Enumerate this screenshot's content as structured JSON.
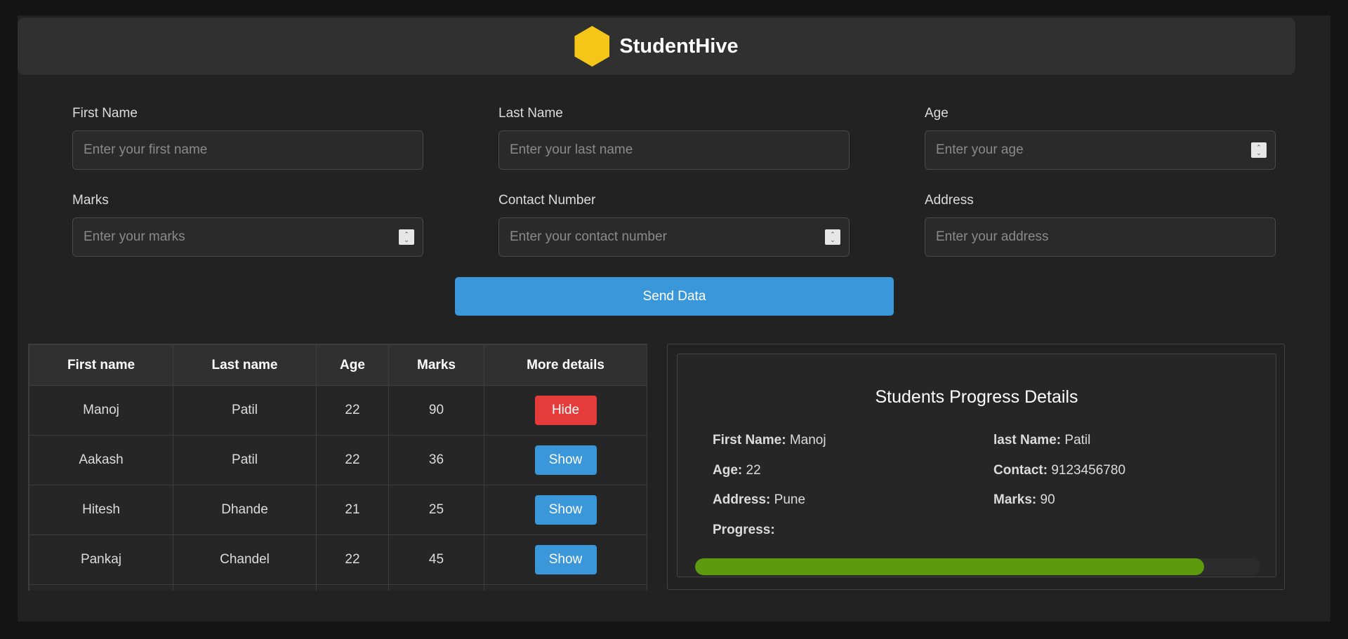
{
  "app": {
    "brand": "StudentHive"
  },
  "form": {
    "first_name": {
      "label": "First Name",
      "placeholder": "Enter your first name",
      "value": ""
    },
    "last_name": {
      "label": "Last Name",
      "placeholder": "Enter your last name",
      "value": ""
    },
    "age": {
      "label": "Age",
      "placeholder": "Enter your age",
      "value": ""
    },
    "marks": {
      "label": "Marks",
      "placeholder": "Enter your marks",
      "value": ""
    },
    "contact": {
      "label": "Contact Number",
      "placeholder": "Enter your contact number",
      "value": ""
    },
    "address": {
      "label": "Address",
      "placeholder": "Enter your address",
      "value": ""
    },
    "send_label": "Send Data"
  },
  "table": {
    "headers": [
      "First name",
      "Last name",
      "Age",
      "Marks",
      "More details"
    ],
    "rows": [
      {
        "first": "Manoj",
        "last": "Patil",
        "age": "22",
        "marks": "90",
        "action": "Hide"
      },
      {
        "first": "Aakash",
        "last": "Patil",
        "age": "22",
        "marks": "36",
        "action": "Show"
      },
      {
        "first": "Hitesh",
        "last": "Dhande",
        "age": "21",
        "marks": "25",
        "action": "Show"
      },
      {
        "first": "Pankaj",
        "last": "Chandel",
        "age": "22",
        "marks": "45",
        "action": "Show"
      },
      {
        "first": "",
        "last": "",
        "age": "",
        "marks": "",
        "action": ""
      }
    ]
  },
  "details": {
    "title": "Students Progress Details",
    "first_name_label": "First Name:",
    "first_name": "Manoj",
    "last_name_label": "last Name:",
    "last_name": "Patil",
    "age_label": "Age:",
    "age": "22",
    "contact_label": "Contact:",
    "contact": "9123456780",
    "address_label": "Address:",
    "address": "Pune",
    "marks_label": "Marks:",
    "marks": "90",
    "progress_label": "Progress:",
    "progress_percent": 90
  },
  "colors": {
    "accent": "#3a97d9",
    "danger": "#e53b3b",
    "progress": "#5e9a0e",
    "logo": "#f5c518"
  },
  "icons": {
    "logo": "hexagon-logo-icon",
    "spinner": "number-spinner-icon"
  }
}
